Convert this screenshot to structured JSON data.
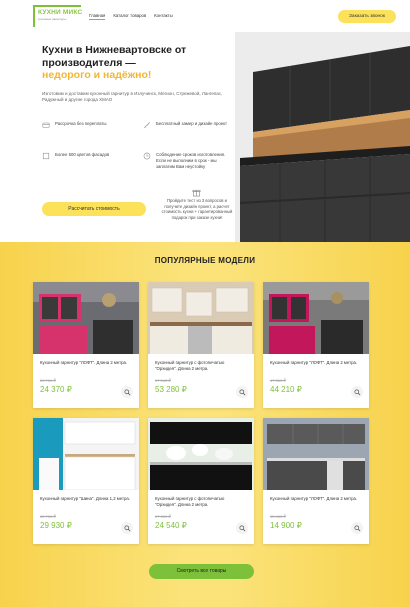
{
  "header": {
    "logo_text": "КУХНИ МИКС",
    "logo_subtext": "кухонные гарнитуры",
    "nav": [
      "Главная",
      "Каталог товаров",
      "Контакты"
    ],
    "call_button": "Заказать звонок"
  },
  "hero": {
    "title": "Кухни в Нижневартовске от производителя —",
    "title_accent": "недорого и надёжно!",
    "description": "Изготовим и доставим кухонный гарнитур в Излучинск, Мегион, Стрежевой, Лангепас, Радужный и другие города ХМАО",
    "features": [
      "Рассрочка без переплаты",
      "Бесплатный замер и дизайн проект",
      "Более 500 цветов фасадов",
      "Соблюдение сроков изготовления. Если не выполним в срок - мы заплатим Вам неустойку"
    ],
    "calc_button": "Рассчитать стоимость",
    "promo_text": "Пройдите тест из 3 вопросов и получите дизайн проект, а расчет стоимость кухни + гарантированный подарок при заказе кухни!"
  },
  "models": {
    "title": "ПОПУЛЯРНЫЕ МОДЕЛИ",
    "items": [
      {
        "name": "Кухонный гарнитур \"ЛОФТ\". Длина 2 метра.",
        "old_price": "26 760 ₽",
        "price": "24 370 ₽"
      },
      {
        "name": "Кухонный гарнитур с фотопечатью \"Орхидея\". Длина 2 метра.",
        "old_price": "57 540 ₽",
        "price": "53 280 ₽"
      },
      {
        "name": "Кухонный гарнитур \"ЛОФТ\". Длина 2 метра.",
        "old_price": "47 360 ₽",
        "price": "44 210 ₽"
      },
      {
        "name": "Кухонный гарнитур \"Шина\". Длина 1,2 метра.",
        "old_price": "32 750 ₽",
        "price": "29 930 ₽"
      },
      {
        "name": "Кухонный гарнитур с фотопечатью \"Орхидея\". Длина 2 метра.",
        "old_price": "27 350 ₽",
        "price": "24 540 ₽"
      },
      {
        "name": "Кухонный гарнитур \"ЛОФТ\". Длина 2 метра.",
        "old_price": "15 480 ₽",
        "price": "14 900 ₽"
      }
    ],
    "all_button": "Смотреть все товары"
  },
  "colors": {
    "accent_yellow": "#fce15b",
    "accent_green": "#7dc13a",
    "title_accent": "#f2b632"
  },
  "icons": [
    "credit-card-icon",
    "ruler-icon",
    "palette-icon",
    "clock-icon",
    "gift-icon",
    "search-icon"
  ]
}
